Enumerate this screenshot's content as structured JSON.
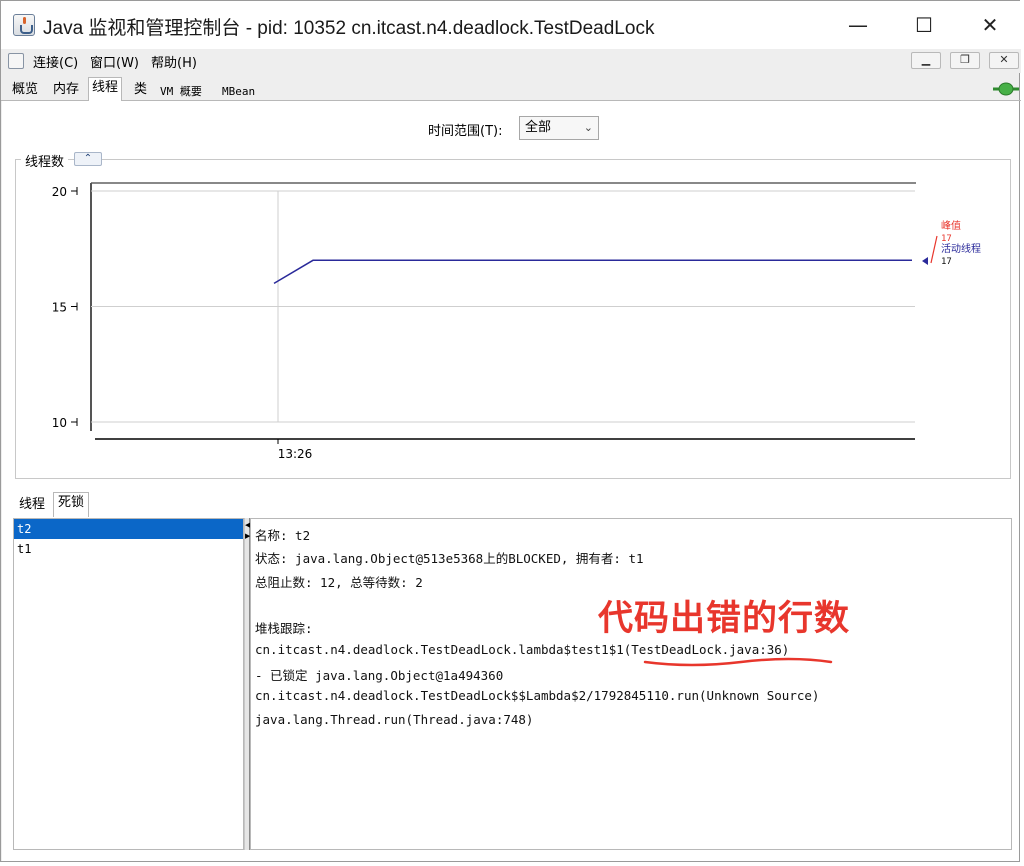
{
  "window": {
    "title": "Java 监视和管理控制台 - pid: 10352 cn.itcast.n4.deadlock.TestDeadLock",
    "minimize": "—",
    "maximize": "☐",
    "close": "✕"
  },
  "menu": {
    "items": [
      {
        "label": "连接(C)"
      },
      {
        "label": "窗口(W)"
      },
      {
        "label": "帮助(H)"
      }
    ],
    "mdi_minimize": "▁",
    "mdi_restore": "❐",
    "mdi_close": "✕"
  },
  "tabs": [
    {
      "label": "概览"
    },
    {
      "label": "内存"
    },
    {
      "label": "线程",
      "active": true
    },
    {
      "label": "类"
    },
    {
      "label": "VM 概要"
    },
    {
      "label": "MBean"
    }
  ],
  "time_range": {
    "label": "时间范围(T):",
    "value": "全部"
  },
  "chart": {
    "title": "线程数",
    "collapse_symbol": "⌃"
  },
  "chart_data": {
    "type": "line",
    "title": "线程数",
    "x_ticks": [
      "13:26"
    ],
    "y_ticks": [
      10,
      15,
      20
    ],
    "ylim": [
      10,
      20
    ],
    "series": [
      {
        "name": "活动线程",
        "color": "#2a2a9a",
        "values": [
          16,
          17,
          17,
          17,
          17,
          17,
          17,
          17,
          17,
          17,
          17,
          17,
          17,
          17,
          17,
          17,
          17,
          17,
          17,
          17,
          17
        ]
      }
    ],
    "legend": [
      {
        "label": "峰值",
        "value": "17",
        "color": "#e8362c"
      },
      {
        "label": "活动线程",
        "value": "17",
        "color": "#2a2a9a"
      }
    ],
    "grid": true,
    "legend_position": "right"
  },
  "lower_tabs": [
    {
      "label": "线程"
    },
    {
      "label": "死锁",
      "active": true
    }
  ],
  "threads": [
    {
      "name": "t2",
      "selected": true
    },
    {
      "name": "t1",
      "selected": false
    }
  ],
  "detail": {
    "name_line": "名称: t2",
    "state_line": "状态: java.lang.Object@513e5368上的BLOCKED, 拥有者: t1",
    "counts_line": "总阻止数: 12, 总等待数: 2",
    "stack_label": "堆栈跟踪:",
    "stack": [
      "cn.itcast.n4.deadlock.TestDeadLock.lambda$test1$1(TestDeadLock.java:36)",
      "   - 已锁定 java.lang.Object@1a494360",
      "cn.itcast.n4.deadlock.TestDeadLock$$Lambda$2/1792845110.run(Unknown Source)",
      "java.lang.Thread.run(Thread.java:748)"
    ]
  },
  "annotation": {
    "text": "代码出错的行数",
    "color": "#e8362c"
  }
}
